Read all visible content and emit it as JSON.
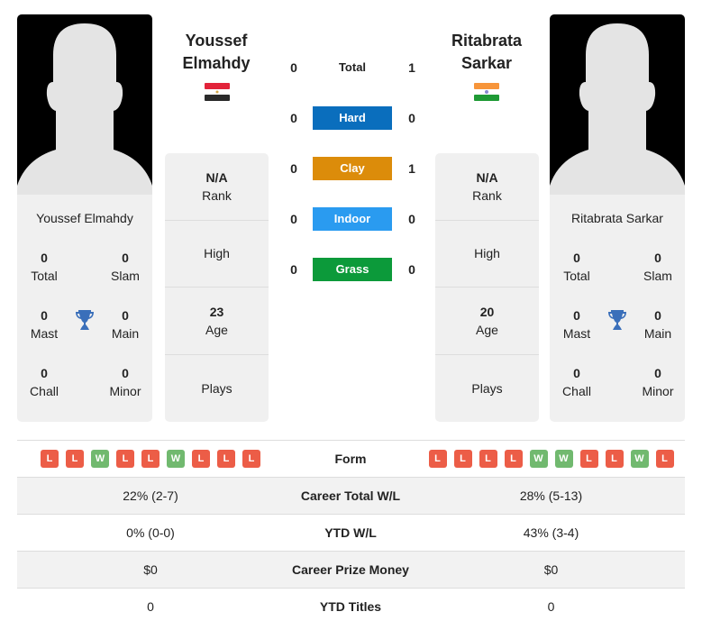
{
  "players": [
    {
      "name": "Youssef Elmahdy",
      "header_name_line1": "Youssef",
      "header_name_line2": "Elmahdy",
      "country_flag": "egypt-flag",
      "titles": {
        "total": {
          "value": "0",
          "label": "Total"
        },
        "slam": {
          "value": "0",
          "label": "Slam"
        },
        "mast": {
          "value": "0",
          "label": "Mast"
        },
        "main": {
          "value": "0",
          "label": "Main"
        },
        "chall": {
          "value": "0",
          "label": "Chall"
        },
        "minor": {
          "value": "0",
          "label": "Minor"
        }
      },
      "info": {
        "rank": {
          "value": "N/A",
          "label": "Rank"
        },
        "high": {
          "label": "High"
        },
        "age": {
          "value": "23",
          "label": "Age"
        },
        "plays": {
          "label": "Plays"
        }
      },
      "form": [
        "L",
        "L",
        "W",
        "L",
        "L",
        "W",
        "L",
        "L",
        "L"
      ],
      "career_total_wl": "22% (2-7)",
      "ytd_wl": "0% (0-0)",
      "career_prize_money": "$0",
      "ytd_titles": "0"
    },
    {
      "name": "Ritabrata Sarkar",
      "header_name_line1": "Ritabrata",
      "header_name_line2": "Sarkar",
      "country_flag": "india-flag",
      "titles": {
        "total": {
          "value": "0",
          "label": "Total"
        },
        "slam": {
          "value": "0",
          "label": "Slam"
        },
        "mast": {
          "value": "0",
          "label": "Mast"
        },
        "main": {
          "value": "0",
          "label": "Main"
        },
        "chall": {
          "value": "0",
          "label": "Chall"
        },
        "minor": {
          "value": "0",
          "label": "Minor"
        }
      },
      "info": {
        "rank": {
          "value": "N/A",
          "label": "Rank"
        },
        "high": {
          "label": "High"
        },
        "age": {
          "value": "20",
          "label": "Age"
        },
        "plays": {
          "label": "Plays"
        }
      },
      "form": [
        "L",
        "L",
        "L",
        "L",
        "W",
        "W",
        "L",
        "L",
        "W",
        "L"
      ],
      "career_total_wl": "28% (5-13)",
      "ytd_wl": "43% (3-4)",
      "career_prize_money": "$0",
      "ytd_titles": "0"
    }
  ],
  "h2h": [
    {
      "label": "Total",
      "left": "0",
      "right": "1",
      "color": ""
    },
    {
      "label": "Hard",
      "left": "0",
      "right": "0",
      "color": "#0a6ebd"
    },
    {
      "label": "Clay",
      "left": "0",
      "right": "1",
      "color": "#dc8c0a"
    },
    {
      "label": "Indoor",
      "left": "0",
      "right": "0",
      "color": "#2a9bf0"
    },
    {
      "label": "Grass",
      "left": "0",
      "right": "0",
      "color": "#0c9a3a"
    }
  ],
  "table_labels": {
    "form": "Form",
    "career_total_wl": "Career Total W/L",
    "ytd_wl": "YTD W/L",
    "career_prize_money": "Career Prize Money",
    "ytd_titles": "YTD Titles"
  },
  "colors": {
    "loss": "#ec5d47",
    "win": "#71b96f",
    "trophy": "#3a6fba"
  }
}
